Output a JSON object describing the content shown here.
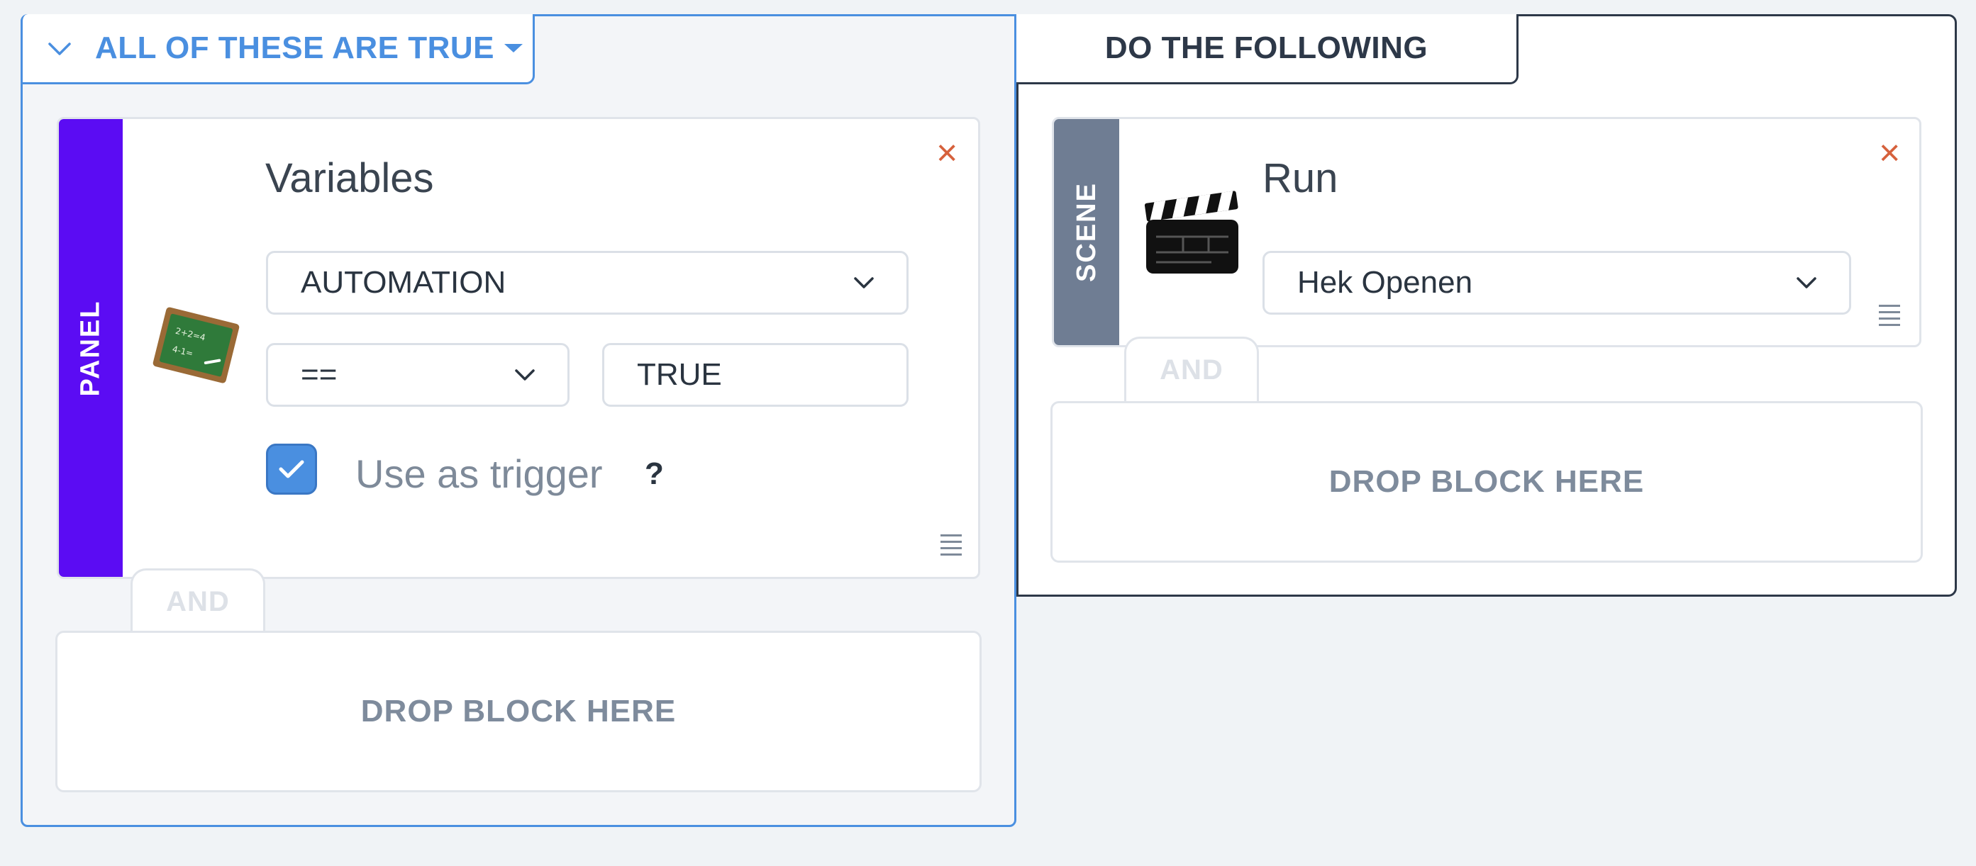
{
  "conditions": {
    "header_label": "ALL OF THESE ARE TRUE",
    "block": {
      "category": "PANEL",
      "title": "Variables",
      "variable_select": "AUTOMATION",
      "operator_select": "==",
      "value": "TRUE",
      "trigger_checked": true,
      "trigger_label": "Use as trigger",
      "help": "?",
      "icon": "chalkboard-icon",
      "stripe_color": "#5b0cf3"
    },
    "and_label": "AND",
    "drop_label": "DROP BLOCK HERE",
    "accent_color": "#4a8fe0"
  },
  "actions": {
    "header_label": "DO THE FOLLOWING",
    "block": {
      "category": "SCENE",
      "title": "Run",
      "scene_select": "Hek Openen",
      "icon": "clapperboard-icon",
      "stripe_color": "#6f7d93"
    },
    "and_label": "AND",
    "drop_label": "DROP BLOCK HERE"
  },
  "icons": {
    "close": "×",
    "close_color": "#d6613c"
  }
}
